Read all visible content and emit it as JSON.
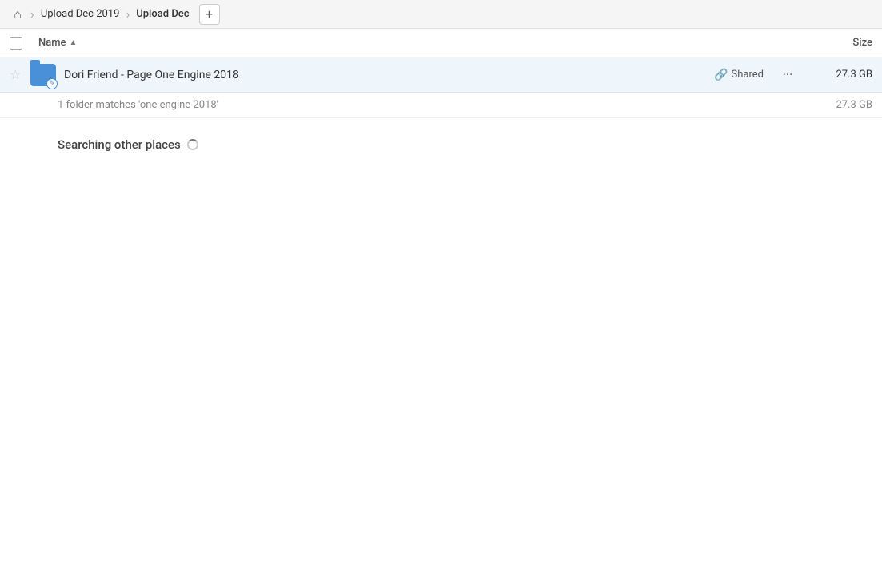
{
  "breadcrumb": {
    "home_icon": "🏠",
    "items": [
      {
        "label": "Upload Dec 2019",
        "active": false
      },
      {
        "label": "Upload Dec",
        "active": true
      }
    ],
    "add_icon": "+"
  },
  "columns": {
    "name_label": "Name",
    "size_label": "Size",
    "sort_arrow": "▲"
  },
  "file_row": {
    "star_icon": "☆",
    "folder_badge": "✎",
    "name": "Dori Friend - Page One Engine 2018",
    "shared_label": "Shared",
    "link_icon": "🔗",
    "more_icon": "···",
    "size": "27.3 GB"
  },
  "summary": {
    "text": "1 folder matches 'one engine 2018'",
    "size": "27.3 GB"
  },
  "searching": {
    "text": "Searching other places"
  }
}
